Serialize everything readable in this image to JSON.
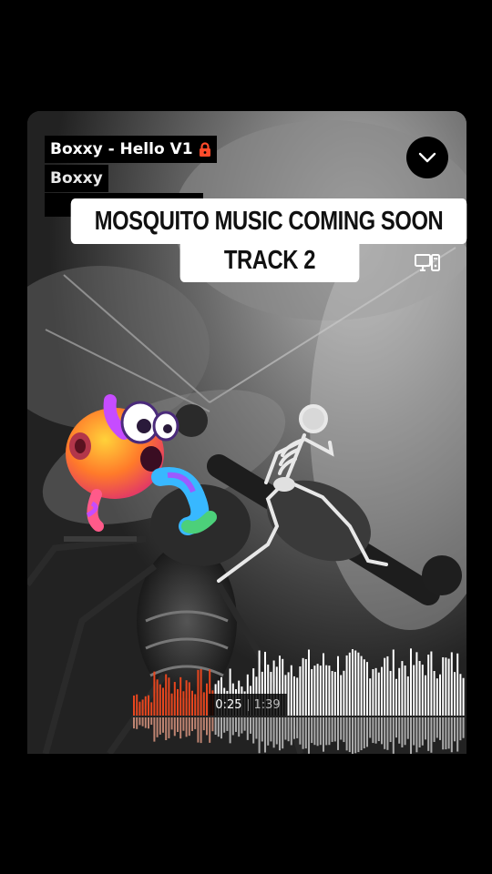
{
  "track": {
    "title": "Boxxy - Hello V1",
    "artist": "Boxxy",
    "lock_icon": "lock-icon"
  },
  "caption": {
    "line1": "MOSQUITO MUSIC COMING SOON",
    "line2": "TRACK 2"
  },
  "controls": {
    "collapse_icon": "chevron-down-icon",
    "device_icon": "monitor-icon"
  },
  "player": {
    "current_time": "0:25",
    "duration": "1:39",
    "progress": 0.25,
    "played_color": "#e8461e",
    "unplayed_color": "#ffffff"
  },
  "colors": {
    "lock_red": "#ff4b2b",
    "background": "#000000"
  }
}
